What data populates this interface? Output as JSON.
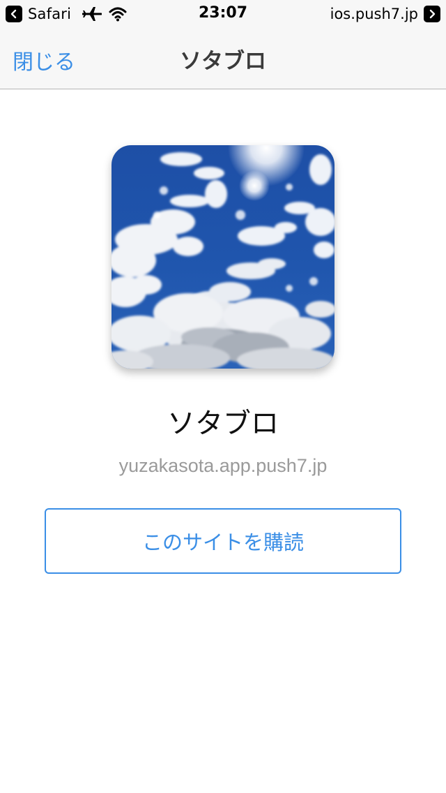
{
  "status_bar": {
    "back_app": "Safari",
    "time": "23:07",
    "site": "ios.push7.jp",
    "icons": [
      "back-arrow-icon",
      "airplane-icon",
      "wifi-icon",
      "forward-arrow-icon"
    ]
  },
  "nav": {
    "close_label": "閉じる",
    "title": "ソタブロ"
  },
  "site": {
    "name": "ソタブロ",
    "url": "yuzakasota.app.push7.jp",
    "icon": "sky-clouds-image"
  },
  "actions": {
    "subscribe_label": "このサイトを購読"
  },
  "colors": {
    "accent": "#3a8ee6",
    "bar_background": "#f7f7f7",
    "secondary_text": "#9a9a9a"
  }
}
